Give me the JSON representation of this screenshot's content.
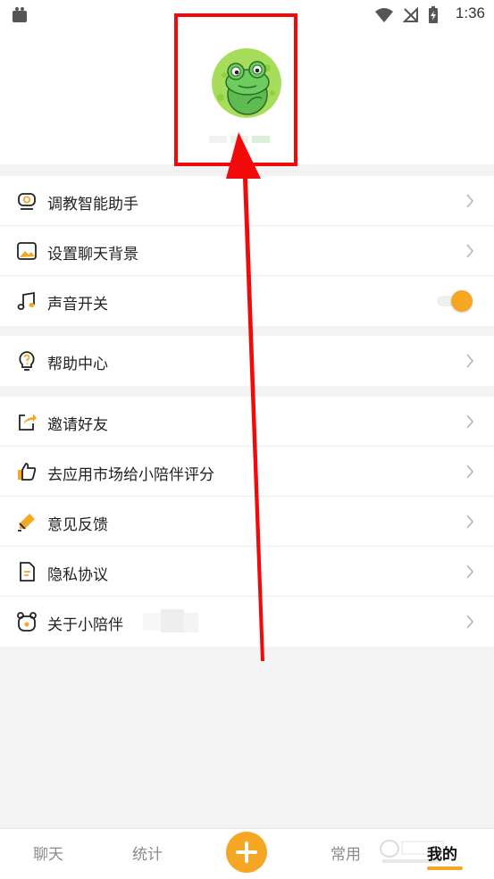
{
  "status_bar": {
    "time": "1:36"
  },
  "menu": {
    "group1": [
      {
        "label": "调教智能助手",
        "icon": "robot-icon"
      },
      {
        "label": "设置聊天背景",
        "icon": "image-icon"
      },
      {
        "label": "声音开关",
        "icon": "music-note-icon",
        "toggle_on": true
      }
    ],
    "group2": [
      {
        "label": "帮助中心",
        "icon": "help-bulb-icon"
      }
    ],
    "group3": [
      {
        "label": "邀请好友",
        "icon": "share-icon"
      },
      {
        "label": "去应用市场给小陪伴评分",
        "icon": "thumbs-up-icon"
      },
      {
        "label": "意见反馈",
        "icon": "pencil-icon"
      },
      {
        "label": "隐私协议",
        "icon": "document-icon"
      },
      {
        "label": "关于小陪伴",
        "icon": "bear-icon"
      }
    ]
  },
  "tabbar": {
    "tabs": [
      {
        "label": "聊天",
        "active": false
      },
      {
        "label": "统计",
        "active": false
      },
      {
        "label": "常用",
        "active": false
      },
      {
        "label": "我的",
        "active": true
      }
    ],
    "add_icon": "plus-icon"
  },
  "colors": {
    "accent": "#f5a623",
    "annotation": "#f20a0a",
    "avatar_bg": "#a6dd5a"
  }
}
